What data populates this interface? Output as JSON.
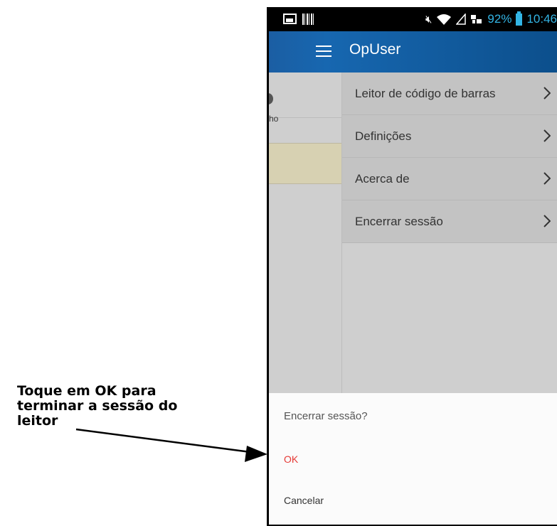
{
  "annotation": {
    "lines": [
      "Toque em OK para",
      "terminar a sessão do",
      "leitor"
    ]
  },
  "status_bar": {
    "battery": "92%",
    "time": "10:46"
  },
  "app_bar": {
    "title": "OpUser"
  },
  "background": {
    "fragment_text": "cho"
  },
  "drawer": {
    "items": [
      {
        "label": "Leitor de código de barras"
      },
      {
        "label": "Definições"
      },
      {
        "label": "Acerca de"
      },
      {
        "label": "Encerrar sessão"
      }
    ]
  },
  "dialog": {
    "title": "Encerrar sessão?",
    "ok_label": "OK",
    "cancel_label": "Cancelar"
  },
  "colors": {
    "accent": "#33b5e5",
    "app_bar": "#0c4f8c",
    "ok": "#e53935"
  }
}
